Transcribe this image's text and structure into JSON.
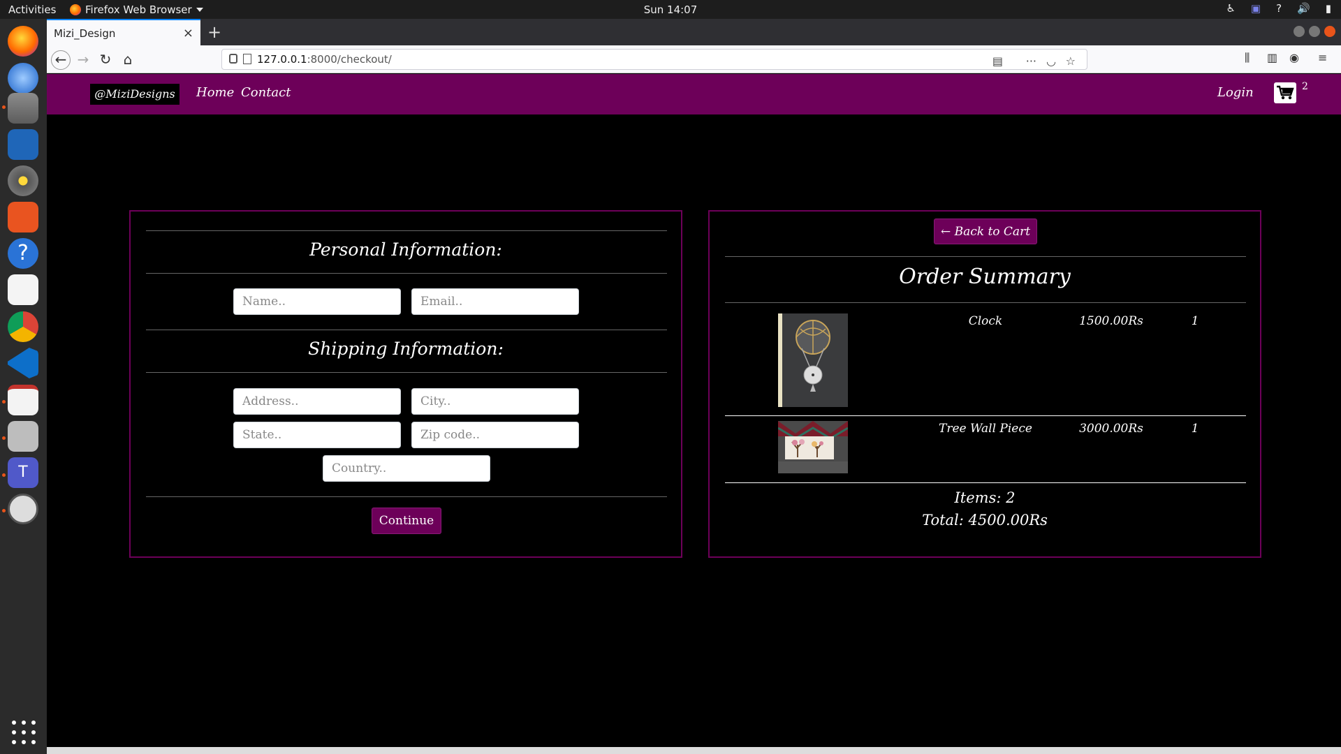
{
  "topbar": {
    "activities": "Activities",
    "app_name": "Firefox Web Browser",
    "clock": "Sun 14:07",
    "tray_icons": [
      "accessibility-icon",
      "teams-icon",
      "help-icon",
      "volume-icon",
      "battery-icon"
    ]
  },
  "dock": {
    "apps": [
      "firefox-icon",
      "thunderbird-icon",
      "files-icon",
      "writer-icon",
      "rhythmbox-icon",
      "software-icon",
      "help-icon",
      "text-editor-icon",
      "chrome-icon",
      "vscode-icon",
      "notes-icon",
      "scanner-icon",
      "teams-icon",
      "updater-icon"
    ]
  },
  "browser": {
    "tab_title": "Mizi_Design",
    "url_host": "127.0.0.1",
    "url_rest": ":8000/checkout/"
  },
  "site": {
    "brand": "@MiziDesigns",
    "nav": {
      "home": "Home",
      "contact": "Contact",
      "login": "Login"
    },
    "cart_count": "2"
  },
  "checkout": {
    "personal_title": "Personal Information:",
    "name_placeholder": "Name..",
    "email_placeholder": "Email..",
    "shipping_title": "Shipping Information:",
    "address_placeholder": "Address..",
    "city_placeholder": "City..",
    "state_placeholder": "State..",
    "zip_placeholder": "Zip code..",
    "country_placeholder": "Country..",
    "continue_label": "Continue"
  },
  "summary": {
    "back_label": "← Back to Cart",
    "title": "Order Summary",
    "items": [
      {
        "name": "Clock",
        "price": "1500.00Rs",
        "qty": "1"
      },
      {
        "name": "Tree Wall Piece",
        "price": "3000.00Rs",
        "qty": "1"
      }
    ],
    "items_count": "Items: 2",
    "total": "Total: 4500.00Rs"
  },
  "colors": {
    "brand_purple": "#6d0059",
    "page_bg": "#000000"
  }
}
